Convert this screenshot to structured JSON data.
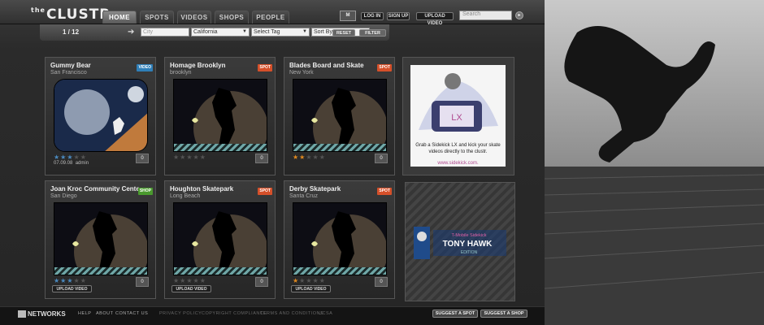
{
  "header": {
    "logo": {
      "prefix": "the",
      "name": "CLUSTR"
    },
    "tabs": [
      {
        "label": "Home",
        "active": true
      },
      {
        "label": "Spots",
        "active": false
      },
      {
        "label": "Videos",
        "active": false
      },
      {
        "label": "Shops",
        "active": false
      },
      {
        "label": "People",
        "active": false
      }
    ],
    "mtv_icon": "mtv-icon",
    "log_in": "LOG IN",
    "sign_up": "SIGN UP",
    "upload_video": "UPLOAD VIDEO",
    "search_placeholder": "Search",
    "search_go": "search-go-icon"
  },
  "filters": {
    "pager": "1 / 12",
    "city_placeholder": "City",
    "state": "California",
    "tag": "Select Tag",
    "sort": "Sort By Date",
    "reset": "RESET",
    "filter": "FILTER"
  },
  "cards": [
    {
      "title": "Gummy Bear",
      "subtitle": "San Francisco",
      "badge": "VIDEO",
      "badge_type": "video",
      "rating": 3,
      "star_color": "blue",
      "count": "0",
      "date": "07.09.08",
      "user": "admin"
    },
    {
      "title": "Homage Brooklyn",
      "subtitle": "brooklyn",
      "badge": "SPOT",
      "badge_type": "spot",
      "rating": 0,
      "star_color": "orange",
      "count": "0"
    },
    {
      "title": "Blades Board and Skate",
      "subtitle": "New York",
      "badge": "SPOT",
      "badge_type": "spot",
      "rating": 2,
      "star_color": "orange",
      "count": "0"
    },
    {
      "title": "Joan Kroc Community Center Skat",
      "subtitle": "San Diego",
      "badge": "SHOP",
      "badge_type": "shop",
      "rating": 3,
      "star_color": "blue",
      "count": "0",
      "action": "UPLOAD VIDEO"
    },
    {
      "title": "Houghton Skatepark",
      "subtitle": "Long Beach",
      "badge": "SPOT",
      "badge_type": "spot",
      "rating": 0,
      "star_color": "orange",
      "count": "0",
      "action": "UPLOAD VIDEO"
    },
    {
      "title": "Derby Skatepark",
      "subtitle": "Santa Cruz",
      "badge": "SPOT",
      "badge_type": "spot",
      "rating": 1,
      "star_color": "orange",
      "count": "0",
      "action": "UPLOAD VIDEO"
    }
  ],
  "ads": {
    "sidekick": {
      "phone_text": "LX",
      "copy": "Grab a Sidekick LX and kick your skate videos directly to the clustr.",
      "url": "www.sidekick.com."
    },
    "tony_hawk": {
      "brand": "T-Mobile Sidekick",
      "name": "TONY HAWK",
      "edition": "EDITION"
    }
  },
  "footer": {
    "networks": "NETWORKS",
    "links": [
      "HELP",
      "ABOUT",
      "CONTACT US"
    ],
    "legal": [
      "PRIVACY POLICY",
      "COPYRIGHT COMPLIANCE",
      "TERMS AND CONDITIONS",
      "UCSA"
    ],
    "suggest_spot": "SUGGEST A SPOT",
    "suggest_shop": "SUGGEST A SHOP"
  },
  "colors": {
    "spot": "#d5502a",
    "video": "#2f7fb8",
    "shop": "#4a9a2e",
    "star_blue": "#4a8ac0",
    "star_orange": "#e0891f"
  }
}
